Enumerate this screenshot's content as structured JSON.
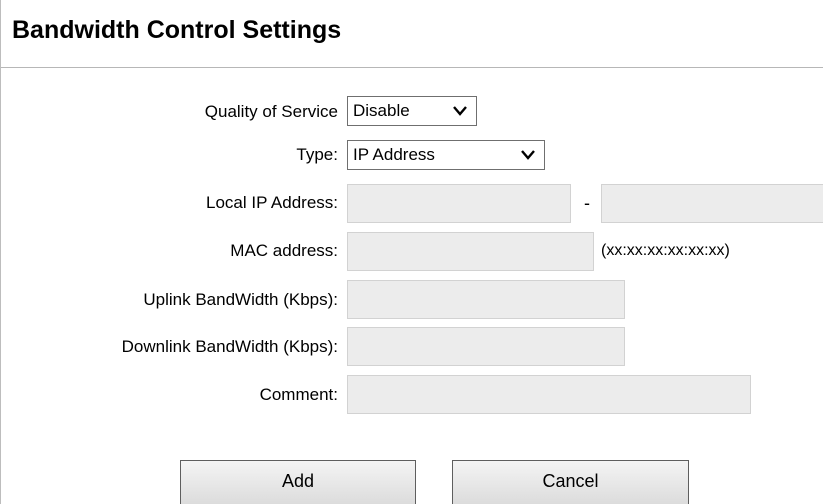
{
  "header": {
    "title": "Bandwidth Control Settings"
  },
  "form": {
    "qos": {
      "label": "Quality of Service",
      "value": "Disable"
    },
    "type": {
      "label": "Type:",
      "value": "IP Address"
    },
    "local_ip": {
      "label": "Local IP Address:",
      "separator": "-",
      "start_value": "",
      "end_value": ""
    },
    "mac": {
      "label": "MAC address:",
      "value": "",
      "hint": "(xx:xx:xx:xx:xx:xx)"
    },
    "uplink": {
      "label": "Uplink BandWidth (Kbps):",
      "value": ""
    },
    "downlink": {
      "label": "Downlink BandWidth (Kbps):",
      "value": ""
    },
    "comment": {
      "label": "Comment:",
      "value": ""
    }
  },
  "buttons": {
    "add": "Add",
    "cancel": "Cancel"
  },
  "icons": {
    "dropdown": "chevron-down-icon"
  },
  "colors": {
    "field_bg": "#ececec",
    "border": "#6f6f6f"
  }
}
